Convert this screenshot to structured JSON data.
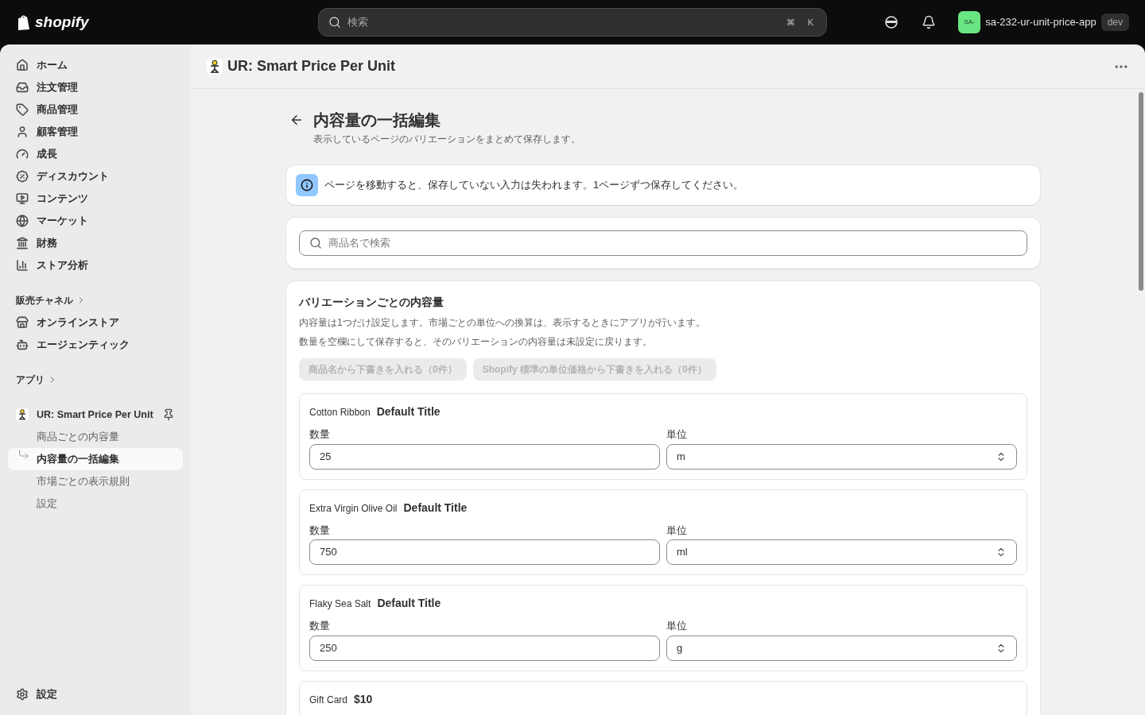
{
  "topbar": {
    "logo_text": "shopify",
    "search": {
      "placeholder": "検索",
      "keys": [
        "⌘",
        "K"
      ]
    },
    "store": {
      "avatar": "SA-",
      "name": "sa-232-ur-unit-price-app",
      "badge": "dev"
    }
  },
  "sidebar": {
    "items": [
      {
        "label": "ホーム",
        "selected": false
      },
      {
        "label": "注文管理",
        "selected": false
      },
      {
        "label": "商品管理",
        "selected": false
      },
      {
        "label": "顧客管理",
        "selected": false
      },
      {
        "label": "成長",
        "selected": false
      },
      {
        "label": "ディスカウント",
        "selected": false
      },
      {
        "label": "コンテンツ",
        "selected": false
      },
      {
        "label": "マーケット",
        "selected": false
      },
      {
        "label": "財務",
        "selected": false
      },
      {
        "label": "ストア分析",
        "selected": false
      }
    ],
    "channels": {
      "heading": "販売チャネル",
      "items": [
        {
          "label": "オンラインストア",
          "selected": false
        },
        {
          "label": "エージェンティック",
          "selected": false
        }
      ]
    },
    "apps": {
      "heading": "アプリ",
      "app": {
        "label": "UR: Smart Price Per Unit",
        "children": [
          {
            "label": "商品ごとの内容量",
            "selected": false
          },
          {
            "label": "内容量の一括編集",
            "selected": true
          },
          {
            "label": "市場ごとの表示規則",
            "selected": false
          },
          {
            "label": "設定",
            "selected": false
          }
        ]
      }
    },
    "footer": {
      "label": "設定"
    }
  },
  "app_header": {
    "title": "UR: Smart Price Per Unit"
  },
  "page": {
    "title": "内容量の一括編集",
    "subtitle": "表示しているページのバリエーションをまとめて保存します。",
    "banner": "ページを移動すると、保存していない入力は失われます。1ページずつ保存してください。",
    "search": {
      "placeholder": "商品名で検索"
    },
    "section": {
      "title": "バリエーションごとの内容量",
      "notes": [
        "内容量は1つだけ設定します。市場ごとの単位への換算は、表示するときにアプリが行います。",
        "数量を空欄にして保存すると、そのバリエーションの内容量は未設定に戻ります。"
      ],
      "buttons": [
        {
          "label": "商品名から下書きを入れる（0件）",
          "disabled": true
        },
        {
          "label": "Shopify 標準の単位価格から下書きを入れる（0件）",
          "disabled": true
        }
      ],
      "variants": [
        {
          "product": "Cotton Ribbon",
          "variant": "Default Title",
          "quantity_label": "数量",
          "quantity": "25",
          "unit_label": "単位",
          "unit": "m"
        },
        {
          "product": "Extra Virgin Olive Oil",
          "variant": "Default Title",
          "quantity_label": "数量",
          "quantity": "750",
          "unit_label": "単位",
          "unit": "ml"
        },
        {
          "product": "Flaky Sea Salt",
          "variant": "Default Title",
          "quantity_label": "数量",
          "quantity": "250",
          "unit_label": "単位",
          "unit": "g"
        },
        {
          "product": "Gift Card",
          "variant": "$10"
        }
      ]
    }
  }
}
